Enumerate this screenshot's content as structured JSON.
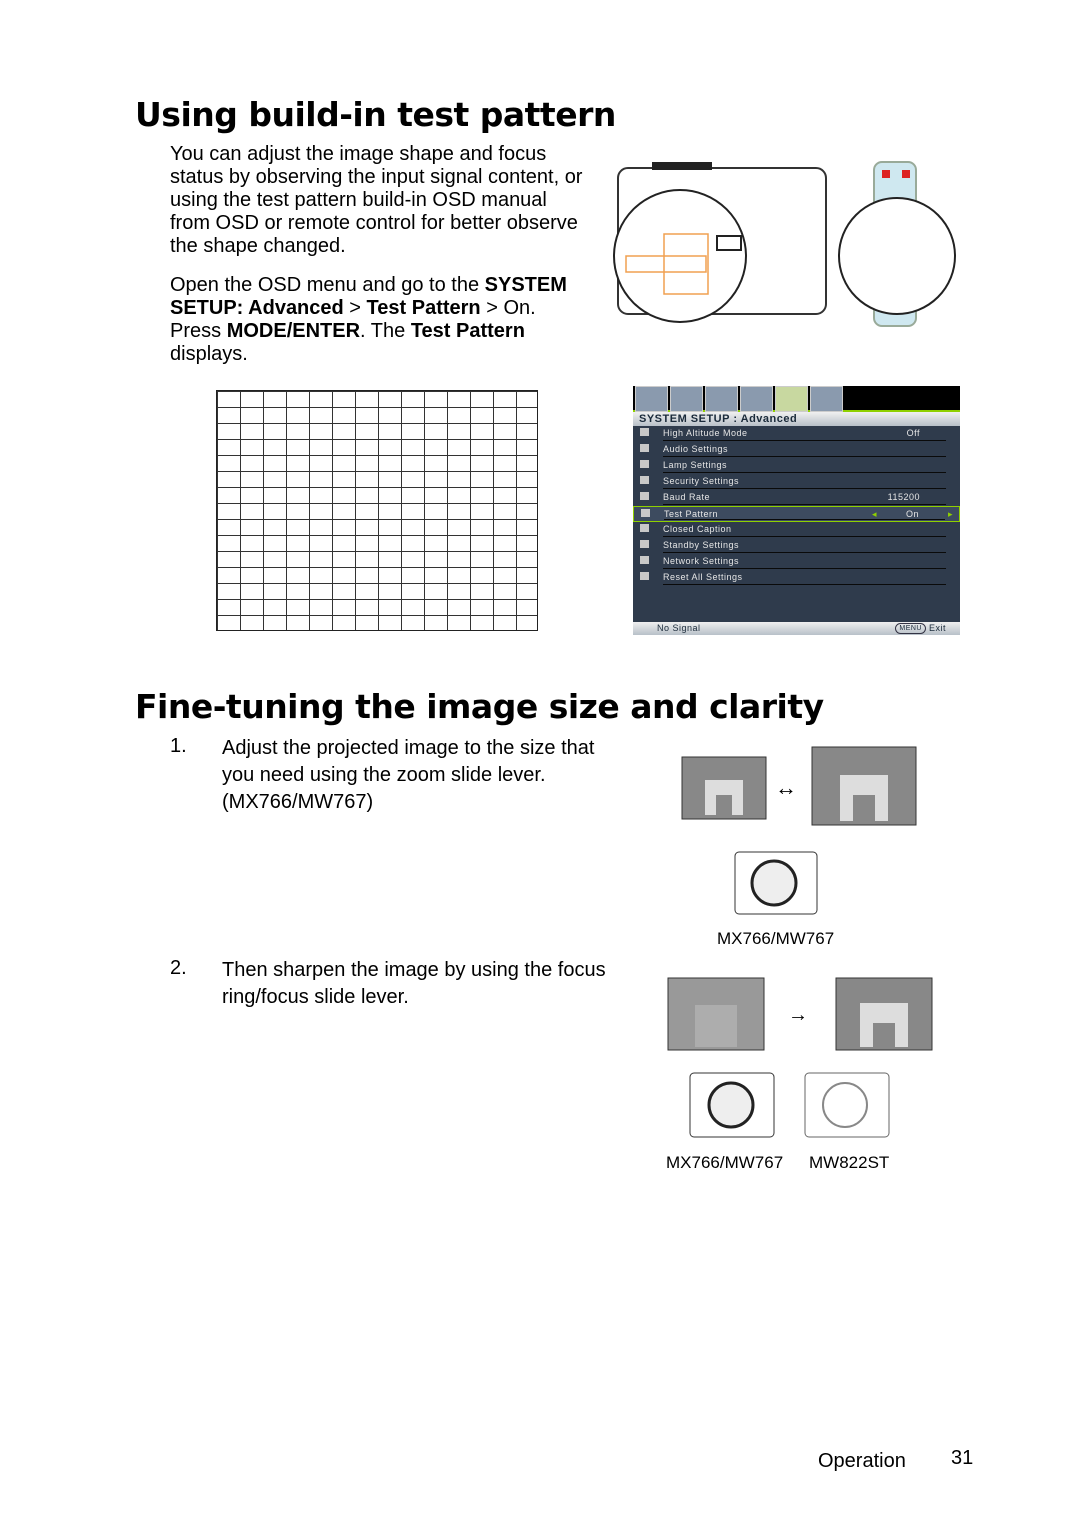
{
  "section1": {
    "title": "Using build-in test pattern",
    "para1": "You can adjust the image shape and focus status by observing the input signal content, or using the test pattern build-in OSD manual from OSD or remote control for better observe the shape changed.",
    "para2": {
      "t1": "Open the OSD menu and go to the ",
      "b1": "SYSTEM SETUP: Advanced",
      "t2": " > ",
      "b2": "Test Pattern",
      "t3": " > On. Press ",
      "b3": "MODE/ENTER",
      "t4": ". The ",
      "b4": "Test Pattern",
      "t5": " displays."
    }
  },
  "test_pattern": {
    "columns": 14,
    "rows": 15
  },
  "osd": {
    "header": "SYSTEM SETUP : Advanced",
    "items": [
      {
        "label": "High Altitude Mode",
        "value": "Off"
      },
      {
        "label": "Audio Settings",
        "value": ""
      },
      {
        "label": "Lamp Settings",
        "value": ""
      },
      {
        "label": "Security Settings",
        "value": ""
      },
      {
        "label": "Baud Rate",
        "value": "115200"
      },
      {
        "label": "Test Pattern",
        "value": "On"
      },
      {
        "label": "Closed Caption",
        "value": ""
      },
      {
        "label": "Standby Settings",
        "value": ""
      },
      {
        "label": "Network Settings",
        "value": ""
      },
      {
        "label": "Reset All Settings",
        "value": ""
      }
    ],
    "footer_left": "No Signal",
    "footer_menu": "MENU",
    "footer_right": "Exit",
    "accent": "#8fd000"
  },
  "section2": {
    "title": "Fine-tuning the image size and clarity",
    "step1_num": "1.",
    "step1": "Adjust the projected image to the size that you need using the zoom slide lever. (MX766/MW767)",
    "step2_num": "2.",
    "step2": "Then sharpen the image by using the focus ring/focus slide lever.",
    "cap1": "MX766/MW767",
    "cap2": "MX766/MW767",
    "cap3": "MW822ST"
  },
  "footer": {
    "section": "Operation",
    "page": "31"
  }
}
